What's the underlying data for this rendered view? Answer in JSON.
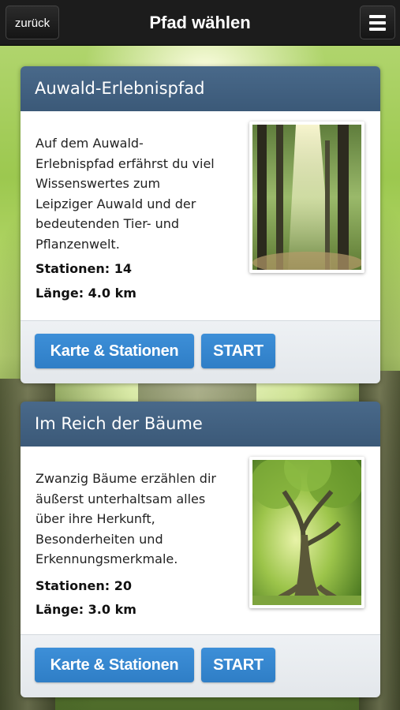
{
  "header": {
    "back_label": "zurück",
    "title": "Pfad wählen",
    "menu_icon": "hamburger-menu-icon"
  },
  "paths": [
    {
      "title": "Auwald-Erlebnispfad",
      "description_lines": [
        "Auf dem Auwald-",
        "Erlebnispfad erfährst du viel",
        "Wissenswertes zum",
        "Leipziger Auwald und der",
        "bedeutenden Tier- und",
        "Pflanzenwelt."
      ],
      "stations": "Stationen: 14",
      "length": "Länge: 4.0 km",
      "image": "forest-sunbeams-photo",
      "map_button": "Karte & Stationen",
      "start_button": "START"
    },
    {
      "title": "Im Reich der Bäume",
      "description_lines": [
        "Zwanzig Bäume erzählen dir",
        "äußerst unterhaltsam alles",
        "über ihre Herkunft,",
        "Besonderheiten und",
        "Erkennungsmerkmale."
      ],
      "stations": "Stationen: 20",
      "length": "Länge: 3.0 km",
      "image": "old-tree-photo",
      "map_button": "Karte & Stationen",
      "start_button": "START"
    }
  ],
  "colors": {
    "topbar": "#1c1c1c",
    "card_header": "#3b5978",
    "button": "#2f7ec6",
    "card_footer": "#e6eaee"
  }
}
